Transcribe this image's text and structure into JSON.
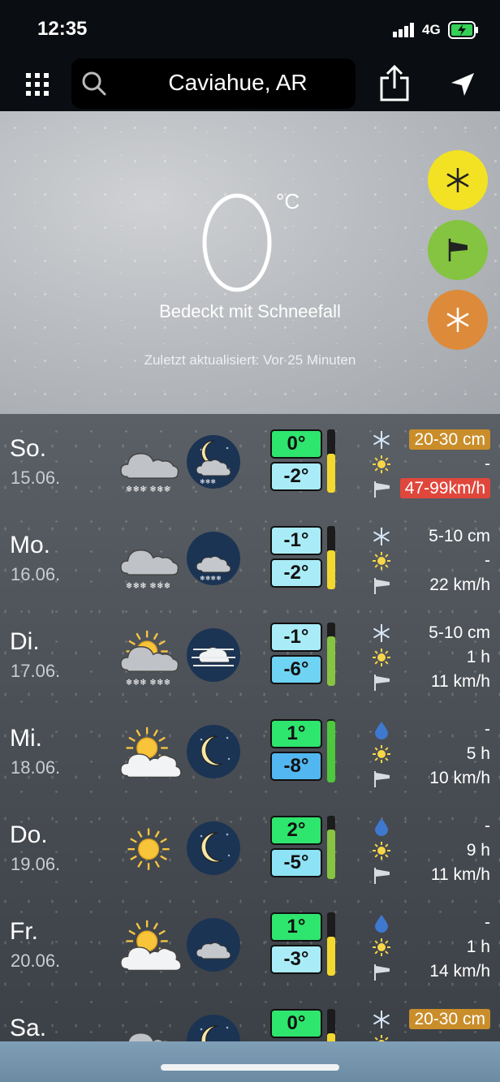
{
  "status": {
    "time": "12:35",
    "network": "4G"
  },
  "nav": {
    "location": "Caviahue, AR"
  },
  "current": {
    "temp": "0",
    "unit": "°C",
    "condition": "Bedeckt mit Schneefall",
    "updated": "Zuletzt aktualisiert: Vor 25 Minuten"
  },
  "colors": {
    "snow_btn": "#f2e223",
    "wind_btn": "#84c440",
    "alert_btn": "#dd8a3a"
  },
  "days": [
    {
      "name": "So.",
      "date": "15.06.",
      "high": "0°",
      "low": "-2°",
      "high_color": "#2ee56e",
      "low_color": "#a9ecf7",
      "bar_color": "#f3d92f",
      "bar_level": 0.62,
      "m1": "20-30 cm",
      "m1_style": "orange",
      "m2": "-",
      "m3": "47-99km/h",
      "m3_style": "red",
      "m1_icon": "snowflake-icon"
    },
    {
      "name": "Mo.",
      "date": "16.06.",
      "high": "-1°",
      "low": "-2°",
      "high_color": "#a9ecf7",
      "low_color": "#a9ecf7",
      "bar_color": "#f3d92f",
      "bar_level": 0.62,
      "m1": "5-10 cm",
      "m1_style": "",
      "m2": "-",
      "m3": "22 km/h",
      "m3_style": "",
      "m1_icon": "snowflake-icon"
    },
    {
      "name": "Di.",
      "date": "17.06.",
      "high": "-1°",
      "low": "-6°",
      "high_color": "#a9ecf7",
      "low_color": "#6fd3f3",
      "bar_color": "#87c441",
      "bar_level": 0.78,
      "m1": "5-10 cm",
      "m1_style": "",
      "m2": "1 h",
      "m3": "11 km/h",
      "m3_style": "",
      "m1_icon": "snowflake-icon"
    },
    {
      "name": "Mi.",
      "date": "18.06.",
      "high": "1°",
      "low": "-8°",
      "high_color": "#2ee56e",
      "low_color": "#52b7f0",
      "bar_color": "#4ec83d",
      "bar_level": 0.98,
      "m1": "-",
      "m1_style": "",
      "m2": "5 h",
      "m3": "10 km/h",
      "m3_style": "",
      "m1_icon": "raindrop-icon"
    },
    {
      "name": "Do.",
      "date": "19.06.",
      "high": "2°",
      "low": "-5°",
      "high_color": "#2ee56e",
      "low_color": "#8ee2f5",
      "bar_color": "#87c441",
      "bar_level": 0.78,
      "m1": "-",
      "m1_style": "",
      "m2": "9 h",
      "m3": "11 km/h",
      "m3_style": "",
      "m1_icon": "raindrop-icon"
    },
    {
      "name": "Fr.",
      "date": "20.06.",
      "high": "1°",
      "low": "-3°",
      "high_color": "#2ee56e",
      "low_color": "#a9ecf7",
      "bar_color": "#f3d92f",
      "bar_level": 0.62,
      "m1": "-",
      "m1_style": "",
      "m2": "1 h",
      "m3": "14 km/h",
      "m3_style": "",
      "m1_icon": "raindrop-icon"
    },
    {
      "name": "Sa.",
      "date": "",
      "high": "0°",
      "low": "",
      "high_color": "#2ee56e",
      "low_color": "#a9ecf7",
      "bar_color": "#f3d92f",
      "bar_level": 0.62,
      "m1": "20-30 cm",
      "m1_style": "orange",
      "m2": "",
      "m3": "",
      "m3_style": "",
      "m1_icon": "snowflake-icon"
    }
  ],
  "day_icons": [
    "cloud-snow-icon",
    "cloud-snow-icon",
    "sun-cloud-snow-icon",
    "sun-cloud-icon",
    "sun-icon",
    "sun-cloud-icon",
    "cloud-icon"
  ],
  "night_icons": [
    "moon-cloud-snow-icon",
    "cloud-snow-night-icon",
    "fog-night-icon",
    "moon-icon",
    "moon-icon",
    "cloud-night-icon",
    "moon-icon"
  ]
}
